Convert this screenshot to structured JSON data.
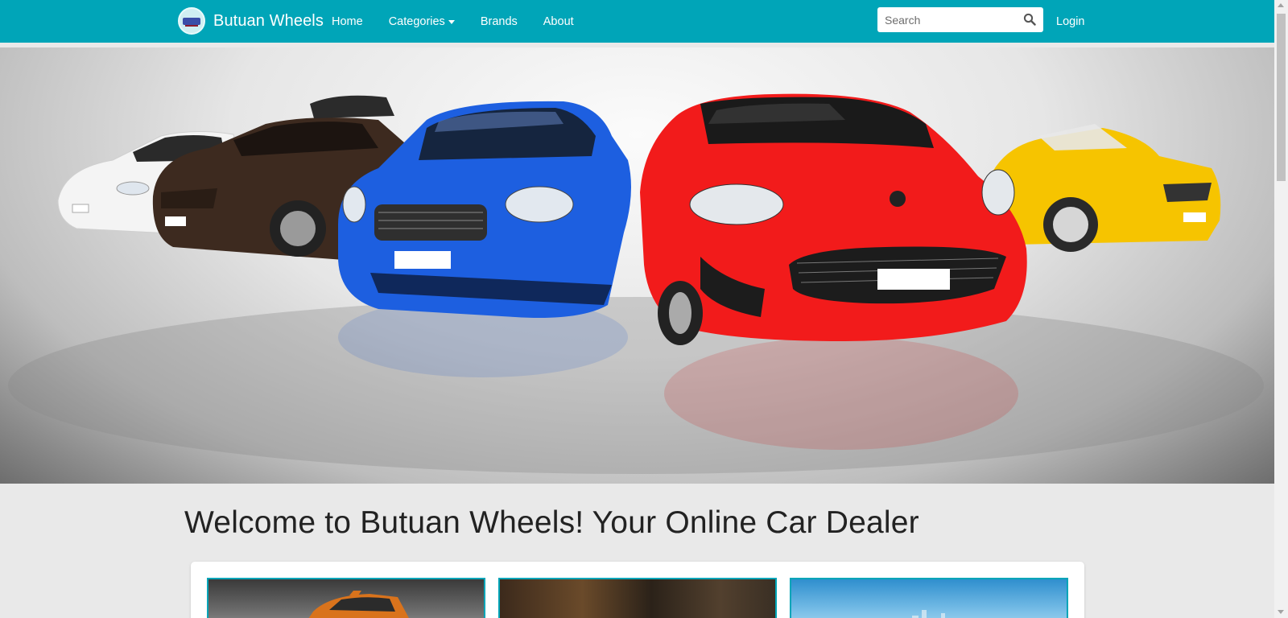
{
  "brand": {
    "name": "Butuan Wheels",
    "logo_icon": "logo-icon"
  },
  "nav": {
    "items": [
      {
        "label": "Home"
      },
      {
        "label": "Categories",
        "dropdown": true
      },
      {
        "label": "Brands"
      },
      {
        "label": "About"
      }
    ]
  },
  "search": {
    "placeholder": "Search",
    "value": "",
    "icon": "search-icon"
  },
  "login": {
    "label": "Login"
  },
  "hero": {
    "image": "five-cars-banner"
  },
  "main": {
    "headline": "Welcome to Butuan Wheels! Your Online Car Dealer"
  },
  "colors": {
    "navbar": "#00a5b8",
    "text": "#222222",
    "background": "#e9e9e9"
  }
}
